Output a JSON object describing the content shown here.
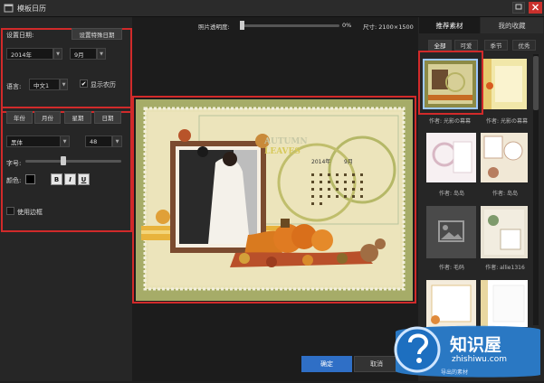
{
  "window": {
    "title": "模板日历"
  },
  "left": {
    "set_date_label": "设置日期:",
    "special_date_btn": "设置特殊日期",
    "year_value": "2014年",
    "month_value": "9月",
    "language_label": "语言:",
    "language_value": "中文1",
    "show_lunar_label": "显示农历",
    "show_lunar_checked": true,
    "tabs": [
      "年份",
      "月份",
      "星期",
      "日期"
    ],
    "font_value": "黑体",
    "size_value": "48",
    "font_size_label": "字号:",
    "color_label": "颜色:",
    "bold": "B",
    "italic": "I",
    "underline": "U",
    "border_label": "使用边框",
    "slider_level": 0.4
  },
  "toolbar": {
    "opacity_label": "照片透明度:",
    "opacity_value": "0%",
    "size_label": "尺寸: 2100×1500"
  },
  "canvas": {
    "autumn_word": "AUTUMN",
    "leaves_word": "LEAVES",
    "cal_year": "2014年",
    "cal_month": "9月"
  },
  "right": {
    "tabs": [
      "推荐素材",
      "我的收藏"
    ],
    "subtabs": [
      "全部",
      "可爱",
      "季节",
      "优秀"
    ],
    "captions": [
      "作者: 光影の幕幕",
      "作者: 光影の幕幕",
      "作者: 岛岛",
      "作者: 岛岛",
      "作者: 毛码",
      "作者: allie1316"
    ]
  },
  "buttons": {
    "ok": "确定",
    "cancel": "取消"
  },
  "watermark": {
    "name": "知识屋",
    "url": "zhishiwu.com",
    "sub": "导出的素材"
  },
  "colors": {
    "highlight": "#d12a2a",
    "ok_button": "#2f6fc6",
    "background": "#1f1f1f"
  }
}
